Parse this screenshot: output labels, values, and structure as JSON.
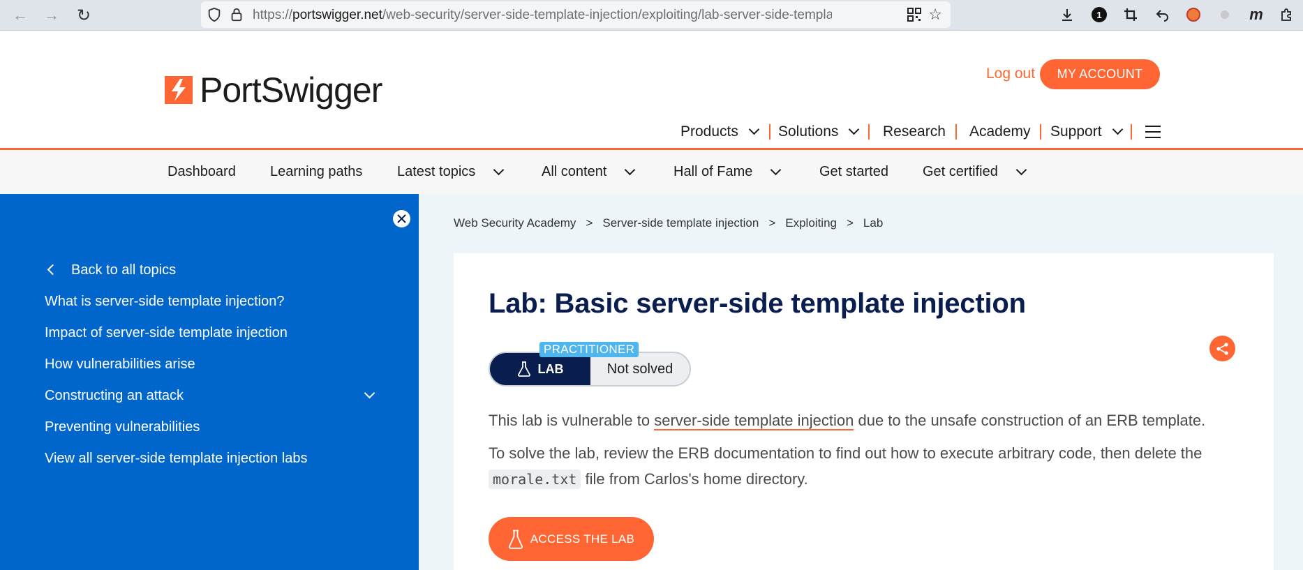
{
  "browser": {
    "url_prefix": "https://",
    "url_host": "portswigger.net",
    "url_path": "/web-security/server-side-template-injection/exploiting/lab-server-side-template-injectic",
    "badge_count": "1"
  },
  "header": {
    "logo_text": "PortSwigger",
    "logout_label": "Log out",
    "account_label": "MY ACCOUNT",
    "nav": {
      "products": "Products",
      "solutions": "Solutions",
      "research": "Research",
      "academy": "Academy",
      "support": "Support"
    }
  },
  "subnav": {
    "dashboard": "Dashboard",
    "learning_paths": "Learning paths",
    "latest_topics": "Latest topics",
    "all_content": "All content",
    "hall_of_fame": "Hall of Fame",
    "get_started": "Get started",
    "get_certified": "Get certified"
  },
  "sidebar": {
    "back": "Back to all topics",
    "items": [
      "What is server-side template injection?",
      "Impact of server-side template injection",
      "How vulnerabilities arise",
      "Constructing an attack",
      "Preventing vulnerabilities",
      "View all server-side template injection labs"
    ]
  },
  "breadcrumb": {
    "c1": "Web Security Academy",
    "c2": "Server-side template injection",
    "c3": "Exploiting",
    "c4": "Lab",
    "sep": ">"
  },
  "lab": {
    "title": "Lab: Basic server-side template injection",
    "level": "PRACTITIONER",
    "badge_label": "LAB",
    "status": "Not solved",
    "p1_before": "This lab is vulnerable to ",
    "p1_link": "server-side template injection",
    "p1_after": " due to the unsafe construction of an ERB template.",
    "p2_line1": "To solve the lab, review the ERB documentation to find out how to execute arbitrary code, then delete the",
    "p2_code": "morale.txt",
    "p2_after": " file from Carlos's home directory.",
    "access_label": "ACCESS THE LAB"
  },
  "colors": {
    "brand_orange": "#ff6633",
    "sidebar_blue": "#0066cc",
    "title_navy": "#0a1d4f",
    "level_blue": "#4fb6ed"
  }
}
